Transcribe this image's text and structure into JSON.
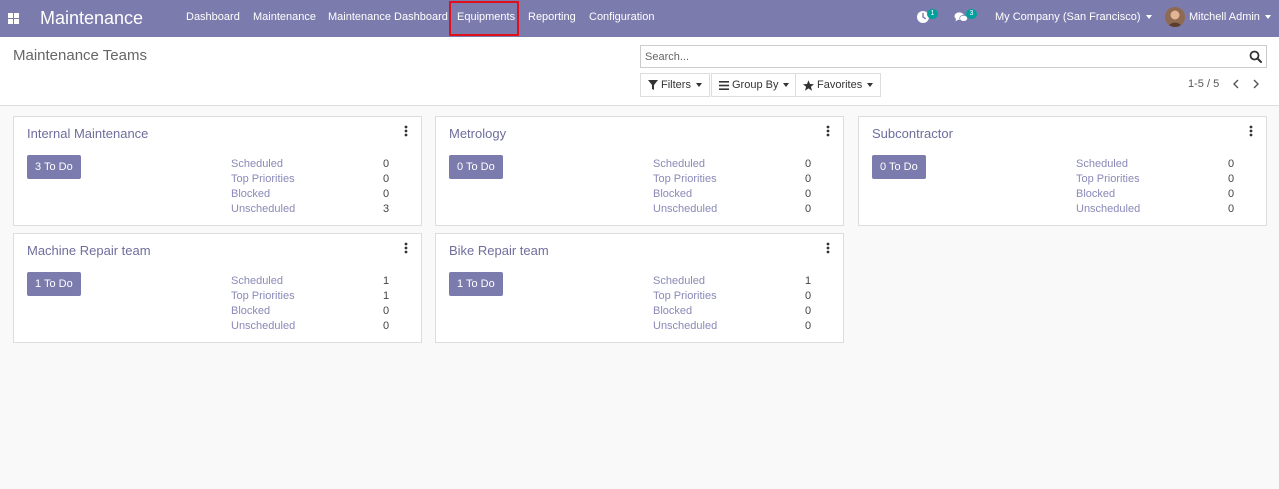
{
  "navbar": {
    "brand": "Maintenance",
    "menu": [
      "Dashboard",
      "Maintenance",
      "Maintenance Dashboard",
      "Equipments",
      "Reporting",
      "Configuration"
    ],
    "activity_count": "1",
    "message_count": "3",
    "company": "My Company (San Francisco)",
    "user": "Mitchell Admin"
  },
  "control_panel": {
    "title": "Maintenance Teams",
    "search_placeholder": "Search...",
    "filters_label": "Filters",
    "groupby_label": "Group By",
    "favorites_label": "Favorites",
    "pager": "1-5 / 5"
  },
  "stat_labels": [
    "Scheduled",
    "Top Priorities",
    "Blocked",
    "Unscheduled"
  ],
  "teams": [
    {
      "name": "Internal Maintenance",
      "todo": "3 To Do",
      "stats": [
        "0",
        "0",
        "0",
        "3"
      ]
    },
    {
      "name": "Metrology",
      "todo": "0 To Do",
      "stats": [
        "0",
        "0",
        "0",
        "0"
      ]
    },
    {
      "name": "Subcontractor",
      "todo": "0 To Do",
      "stats": [
        "0",
        "0",
        "0",
        "0"
      ]
    },
    {
      "name": "Machine Repair team",
      "todo": "1 To Do",
      "stats": [
        "1",
        "1",
        "0",
        "0"
      ]
    },
    {
      "name": "Bike Repair team",
      "todo": "1 To Do",
      "stats": [
        "1",
        "0",
        "0",
        "0"
      ]
    }
  ],
  "colors": {
    "navbar": "#7c7bad",
    "highlight": "#e0101a",
    "badge": "#00a09d"
  }
}
